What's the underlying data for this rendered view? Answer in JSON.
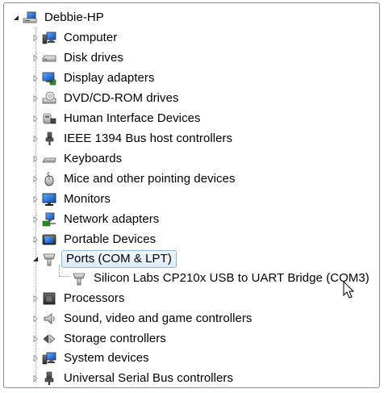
{
  "tree": {
    "root": {
      "label": "Debbie-HP",
      "icon": "computer-icon"
    },
    "items": [
      {
        "label": "Computer",
        "icon": "computer-icon"
      },
      {
        "label": "Disk drives",
        "icon": "disk-drive-icon"
      },
      {
        "label": "Display adapters",
        "icon": "display-adapter-icon"
      },
      {
        "label": "DVD/CD-ROM drives",
        "icon": "dvd-drive-icon"
      },
      {
        "label": "Human Interface Devices",
        "icon": "hid-icon"
      },
      {
        "label": "IEEE 1394 Bus host controllers",
        "icon": "ieee1394-icon"
      },
      {
        "label": "Keyboards",
        "icon": "keyboard-icon"
      },
      {
        "label": "Mice and other pointing devices",
        "icon": "mouse-icon"
      },
      {
        "label": "Monitors",
        "icon": "monitor-icon"
      },
      {
        "label": "Network adapters",
        "icon": "network-adapter-icon"
      },
      {
        "label": "Portable Devices",
        "icon": "portable-device-icon"
      },
      {
        "label": "Ports (COM & LPT)",
        "icon": "port-icon",
        "selected": true,
        "expanded": true
      },
      {
        "label": "Silicon Labs CP210x USB to UART Bridge (COM3)",
        "icon": "port-icon",
        "child": true
      },
      {
        "label": "Processors",
        "icon": "processor-icon"
      },
      {
        "label": "Sound, video and game controllers",
        "icon": "sound-icon"
      },
      {
        "label": "Storage controllers",
        "icon": "storage-controller-icon"
      },
      {
        "label": "System devices",
        "icon": "system-device-icon"
      },
      {
        "label": "Universal Serial Bus controllers",
        "icon": "usb-icon"
      }
    ]
  },
  "colors": {
    "selection_border": "#8fb6e3",
    "selection_fill": "#dbeaf9",
    "tree_line": "#9a9a9a",
    "frame_border": "#8a8f96"
  }
}
